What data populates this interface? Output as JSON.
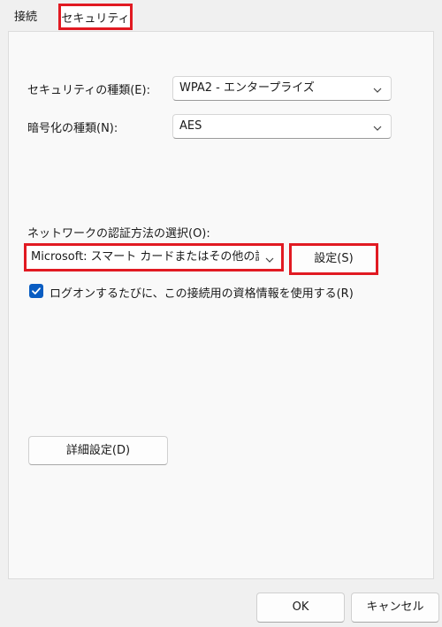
{
  "tabs": {
    "connection": "接続",
    "security": "セキュリティ"
  },
  "security_type": {
    "label": "セキュリティの種類(E):",
    "value": "WPA2 - エンタープライズ"
  },
  "encryption_type": {
    "label": "暗号化の種類(N):",
    "value": "AES"
  },
  "auth_method": {
    "label": "ネットワークの認証方法の選択(O):",
    "value": "Microsoft: スマート カードまたはその他の証明",
    "settings_button": "設定(S)"
  },
  "remember_credentials": {
    "label": "ログオンするたびに、この接続用の資格情報を使用する(R)",
    "checked": true
  },
  "advanced_button": "詳細設定(D)",
  "footer": {
    "ok": "OK",
    "cancel": "キャンセル"
  },
  "colors": {
    "highlight": "#e11a22",
    "checkbox_accent": "#0a5dc2"
  }
}
